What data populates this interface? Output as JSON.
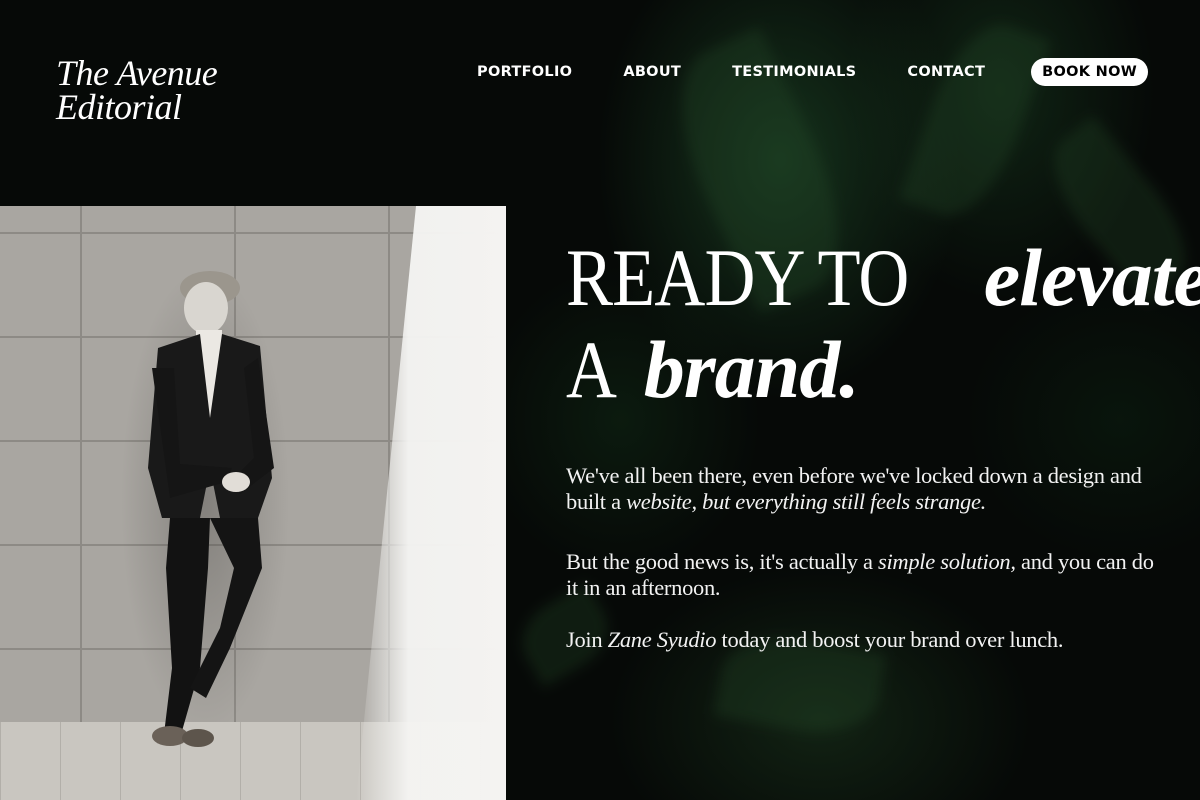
{
  "brand": {
    "line1": "The Avenue",
    "line2": "Editorial"
  },
  "nav": {
    "items": [
      "PORTFOLIO",
      "ABOUT",
      "TESTIMONIALS",
      "CONTACT"
    ],
    "cta": "BOOK NOW"
  },
  "hero": {
    "line1_upright": "READY TO",
    "line1_italic": "elevate",
    "line2_upright": "A",
    "line2_italic": "brand."
  },
  "copy": {
    "p1_a": "We've all been there, even before we've locked down a design and built a ",
    "p1_b": "website, but everything still feels strange.",
    "p2_a": "But the good news is, it's actually a ",
    "p2_b": "simple solution,",
    "p2_c": " and you can do it in an afternoon.",
    "p3_a": "Join ",
    "p3_b": "Zane Syudio",
    "p3_c": " today and boost your brand over lunch."
  },
  "colors": {
    "background": "#070a08",
    "text": "#ffffff",
    "button_bg": "#ffffff",
    "button_text": "#000000"
  }
}
